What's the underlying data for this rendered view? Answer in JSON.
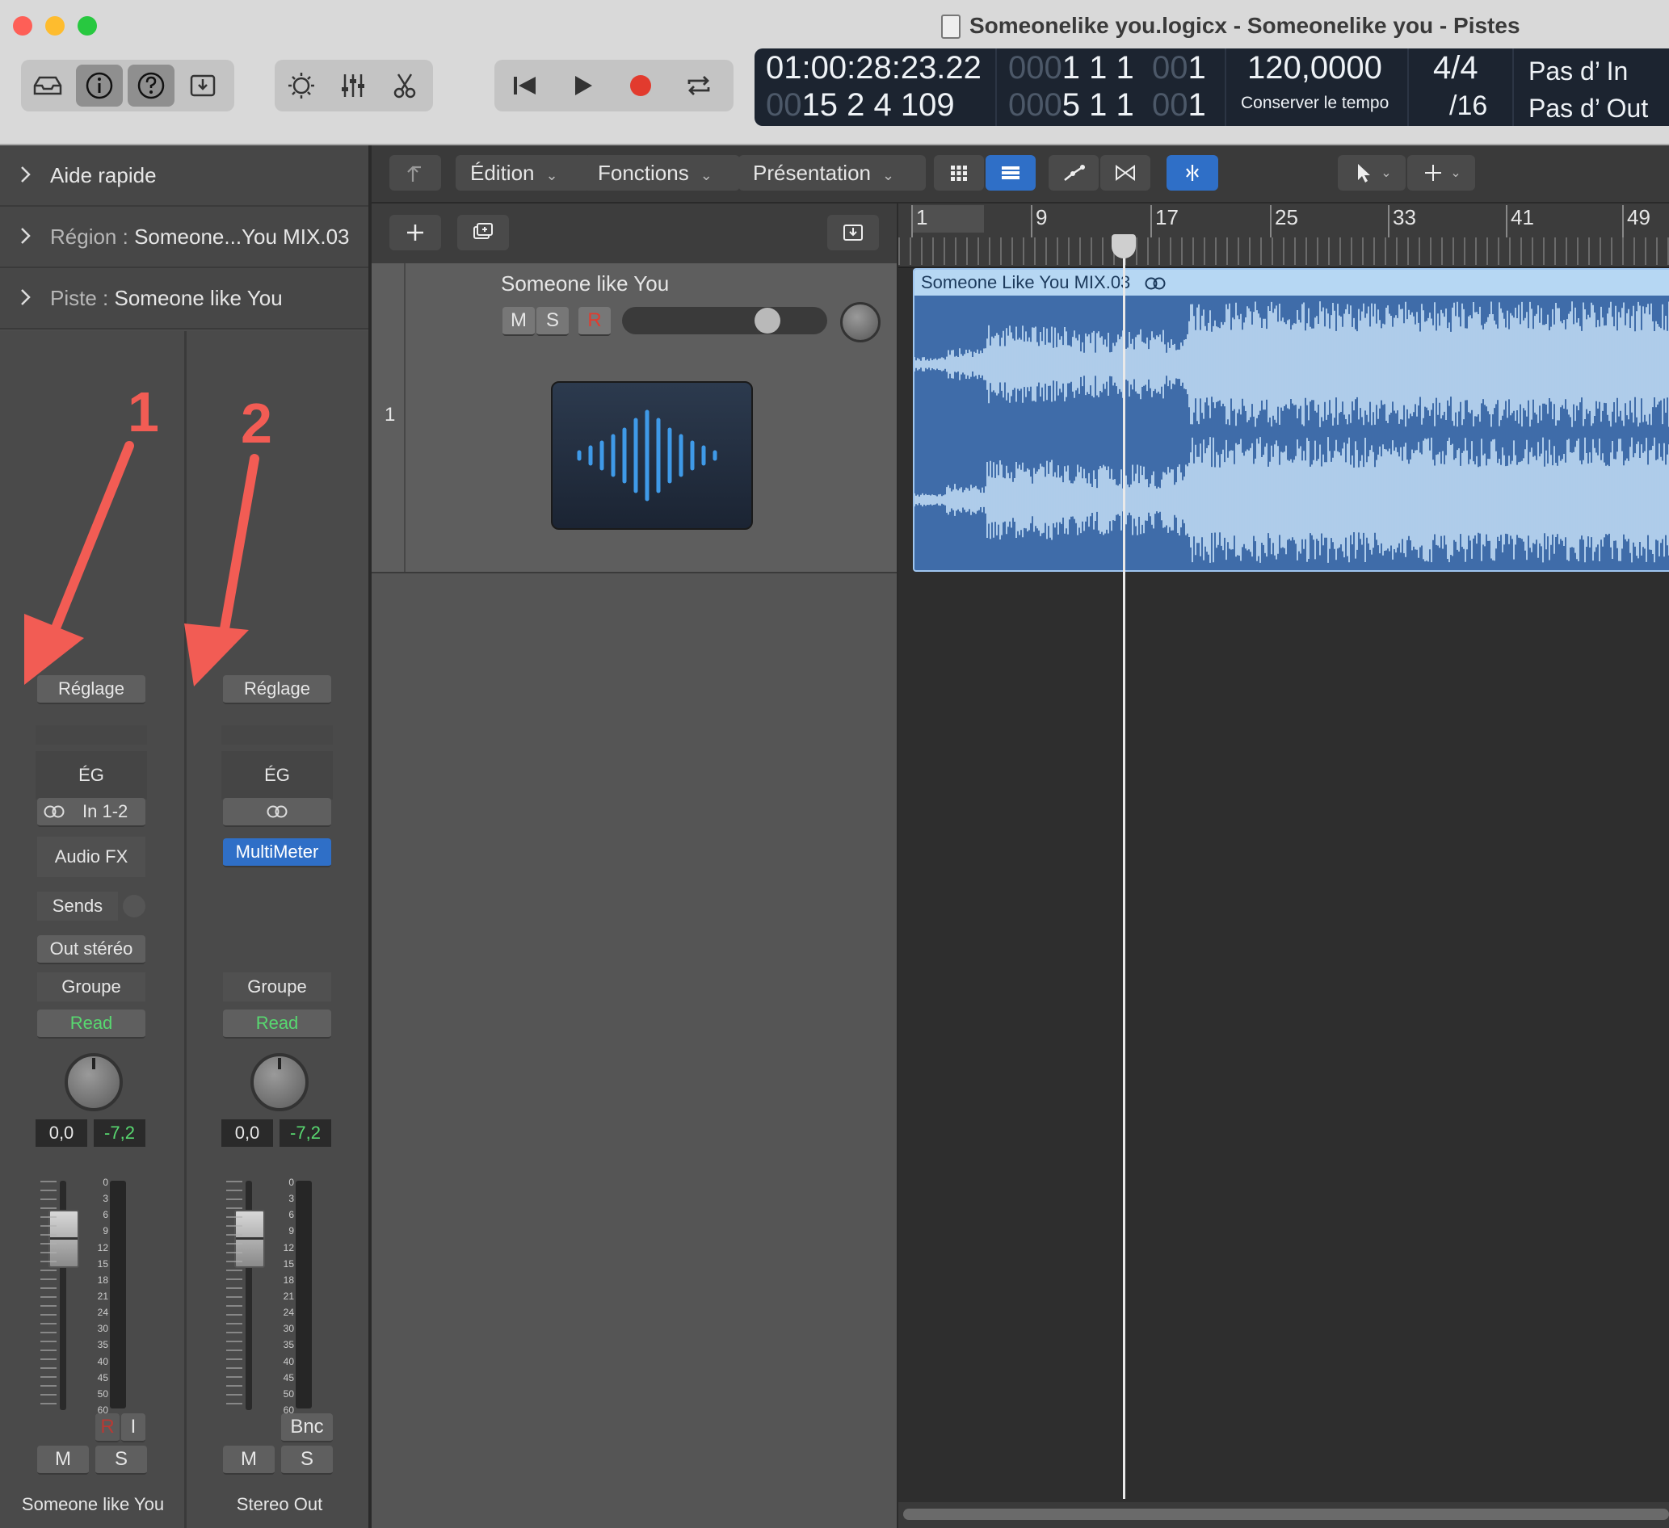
{
  "window": {
    "title": "Someonelike you.logicx - Someonelike you - Pistes"
  },
  "lcd": {
    "time": "01:00:28:23.22",
    "bars_dim": "00",
    "bars": "15  2  4  109",
    "cycle_start_dim": "000",
    "cycle_start": "1  1  1",
    "cycle_start_tail_dim": "00",
    "cycle_start_tail": "1",
    "cycle_end_dim": "000",
    "cycle_end": "5  1  1",
    "cycle_end_tail_dim": "00",
    "cycle_end_tail": "1",
    "tempo": "120,0000",
    "tempo_mode": "Conserver le tempo",
    "signature": "4/4",
    "division": "/16",
    "in": "Pas d’ In",
    "out": "Pas d’ Out"
  },
  "inspector": {
    "quick_help": "Aide rapide",
    "region_label": "Région : ",
    "region_value": "Someone...You MIX.03",
    "track_label": "Piste : ",
    "track_value": "Someone like You"
  },
  "annotations": {
    "arrow1": "1",
    "arrow2": "2",
    "arrow_color": "#f25c54"
  },
  "strip1": {
    "setting": "Réglage",
    "eq": "ÉG",
    "input": "In 1-2",
    "audio_fx": "Audio FX",
    "sends": "Sends",
    "output": "Out stéréo",
    "group": "Groupe",
    "automation": "Read",
    "volume": "0,0",
    "peak": "-7,2",
    "rec": "R",
    "input_monitor": "I",
    "mute": "M",
    "solo": "S",
    "name": "Someone like You"
  },
  "strip2": {
    "setting": "Réglage",
    "eq": "ÉG",
    "plugin": "MultiMeter",
    "group": "Groupe",
    "automation": "Read",
    "volume": "0,0",
    "peak": "-7,2",
    "bounce": "Bnc",
    "mute": "M",
    "solo": "S",
    "name": "Stereo Out"
  },
  "meter_scale": [
    "0",
    "3",
    "6",
    "9",
    "12",
    "15",
    "18",
    "21",
    "24",
    "30",
    "35",
    "40",
    "45",
    "50",
    "60"
  ],
  "menus": {
    "edit": "Édition",
    "functions": "Fonctions",
    "view": "Présentation"
  },
  "track": {
    "number": "1",
    "name": "Someone like You",
    "mute": "M",
    "solo": "S",
    "record": "R"
  },
  "ruler": {
    "bars": [
      "1",
      "9",
      "17",
      "25",
      "33",
      "41",
      "49"
    ]
  },
  "region": {
    "name": "Someone Like You MIX.03"
  },
  "colors": {
    "region_fill": "#3f6ca9",
    "region_header": "#b6d7f3",
    "waveform": "#cbe4fa",
    "record_red": "#e23b2e",
    "read_green": "#58d870",
    "selected_blue": "#2f6fc7"
  }
}
